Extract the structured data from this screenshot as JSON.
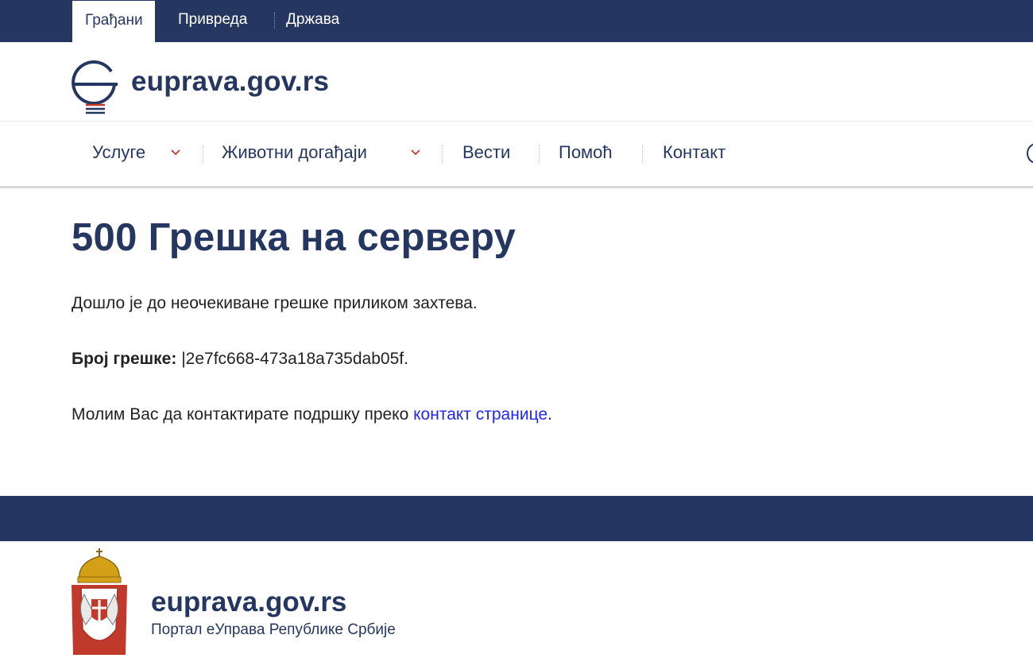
{
  "top_tabs": [
    "Грађани",
    "Привреда",
    "Држава"
  ],
  "brand": {
    "name": "euprava.gov.rs"
  },
  "nav": {
    "items": [
      "Услуге",
      "Животни догађаји",
      "Вести",
      "Помоћ",
      "Контакт"
    ]
  },
  "error": {
    "title": "500 Грешка на серверу",
    "message": "Дошло је до неочекиване грешке приликом захтева.",
    "code_label": "Број грешке:",
    "code_value": "|2e7fc668-473a18a735dab05f.",
    "contact_prefix": "Молим Вас да контактирате подршку преко ",
    "contact_link": "контакт странице",
    "contact_suffix": "."
  },
  "footer": {
    "name": "euprava.gov.rs",
    "subtitle": "Портал еУправа Републике Србије"
  },
  "colors": {
    "brand_navy": "#253760",
    "link": "#1f27f5",
    "accent_red": "#c0392b"
  },
  "icons": {
    "logo": "eupravа-logo-icon",
    "chevron": "chevron-down-icon",
    "search": "search-icon",
    "coat_of_arms": "serbia-coat-of-arms-icon"
  }
}
